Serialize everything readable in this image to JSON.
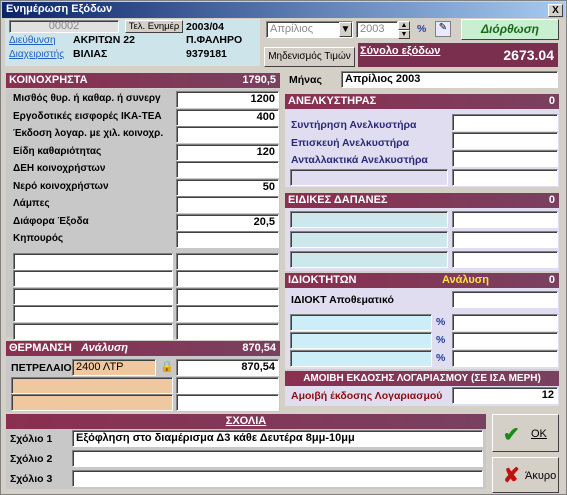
{
  "window": {
    "title": "Ενημέρωση Εξόδων",
    "close": "X"
  },
  "header": {
    "code": "00002",
    "phone_label": "Τελ. Ενημέρ",
    "period": "2003/04",
    "address_label": "Διεύθυνση",
    "street": "ΑΚΡΙΤΩΝ 22",
    "city": "Π.ΦΑΛΗΡΟ",
    "manager_label": "Διαχειριστής",
    "manager": "ΒΙΛΙΑΣ",
    "phone": "9379181"
  },
  "controls": {
    "month": "Απρίλιος",
    "year": "2003",
    "percent": "%",
    "correction": "Διόρθωση",
    "zero_values": "Μηδενισμός Τιμών"
  },
  "total": {
    "label": "Σύνολο εξόδων",
    "value": "2673.04"
  },
  "month_field": {
    "label": "Μήνας",
    "value": "Απρίλιος 2003"
  },
  "common": {
    "title": "ΚΟΙΝΟΧΡΗΣΤΑ",
    "total": "1790,5",
    "rows": [
      {
        "label": "Μισθός θυρ. ή καθαρ. ή συνεργ",
        "value": "1200"
      },
      {
        "label": "Εργοδοτικές εισφορές ΙΚΑ-ΤΕΑ",
        "value": "400"
      },
      {
        "label": "Έκδοση λογαρ. με χιλ. κοινοχρ.",
        "value": ""
      },
      {
        "label": "Είδη καθαριότητας",
        "value": "120"
      },
      {
        "label": "ΔΕΗ κοινοχρήστων",
        "value": ""
      },
      {
        "label": "Νερό κοινοχρήστων",
        "value": "50"
      },
      {
        "label": "Λάμπες",
        "value": ""
      },
      {
        "label": "Διάφορα Έξοδα",
        "value": "20,5"
      },
      {
        "label": "Κηπουρός",
        "value": ""
      }
    ]
  },
  "heating": {
    "title": "ΘΕΡΜΑΝΣΗ",
    "analysis": "Ανάλυση",
    "total": "870,54",
    "fuel_label": "ΠΕΤΡΕΛΑΙΟ",
    "fuel_value": "2400 ΛΤΡ",
    "amount": "870,54"
  },
  "elevator": {
    "title": "ΑΝΕΛΚΥΣΤΗΡΑΣ",
    "total": "0",
    "rows": [
      "Συντήρηση Ανελκυστήρα",
      "Επισκευή Ανελκυστήρα",
      "Ανταλλακτικά Ανελκυστήρα"
    ]
  },
  "special": {
    "title": "ΕΙΔΙΚΕΣ ΔΑΠΑΝΕΣ",
    "total": "0"
  },
  "owners": {
    "title": "ΙΔΙΟΚΤΗΤΩΝ",
    "analysis": "Ανάλυση",
    "total": "0",
    "reserve_label": "ΙΔΙΟΚΤ Αποθεματικό",
    "percent": "%"
  },
  "fee": {
    "title": "ΑΜΟΙΒΗ ΕΚΔΟΣΗΣ ΛΟΓΑΡΙΑΣΜΟΥ (ΣΕ ΙΣΑ ΜΕΡΗ)",
    "label": "Αμοιβή έκδοσης Λογαριασμού",
    "value": "12"
  },
  "comments": {
    "title": "ΣΧΟΛΙΑ",
    "rows": [
      {
        "label": "Σχόλιο 1",
        "value": "Εξόφληση στο διαμέρισμα Δ3 κάθε Δευτέρα 8μμ-10μμ"
      },
      {
        "label": "Σχόλιο 2",
        "value": ""
      },
      {
        "label": "Σχόλιο 3",
        "value": ""
      }
    ]
  },
  "buttons": {
    "ok": "ΟΚ",
    "cancel": "Άκυρο"
  },
  "colors": {
    "header_gradient": "#8a2f50",
    "title_bar": "#0a246a",
    "ok_check": "#1a8a1a",
    "cancel_x": "#c01010"
  }
}
